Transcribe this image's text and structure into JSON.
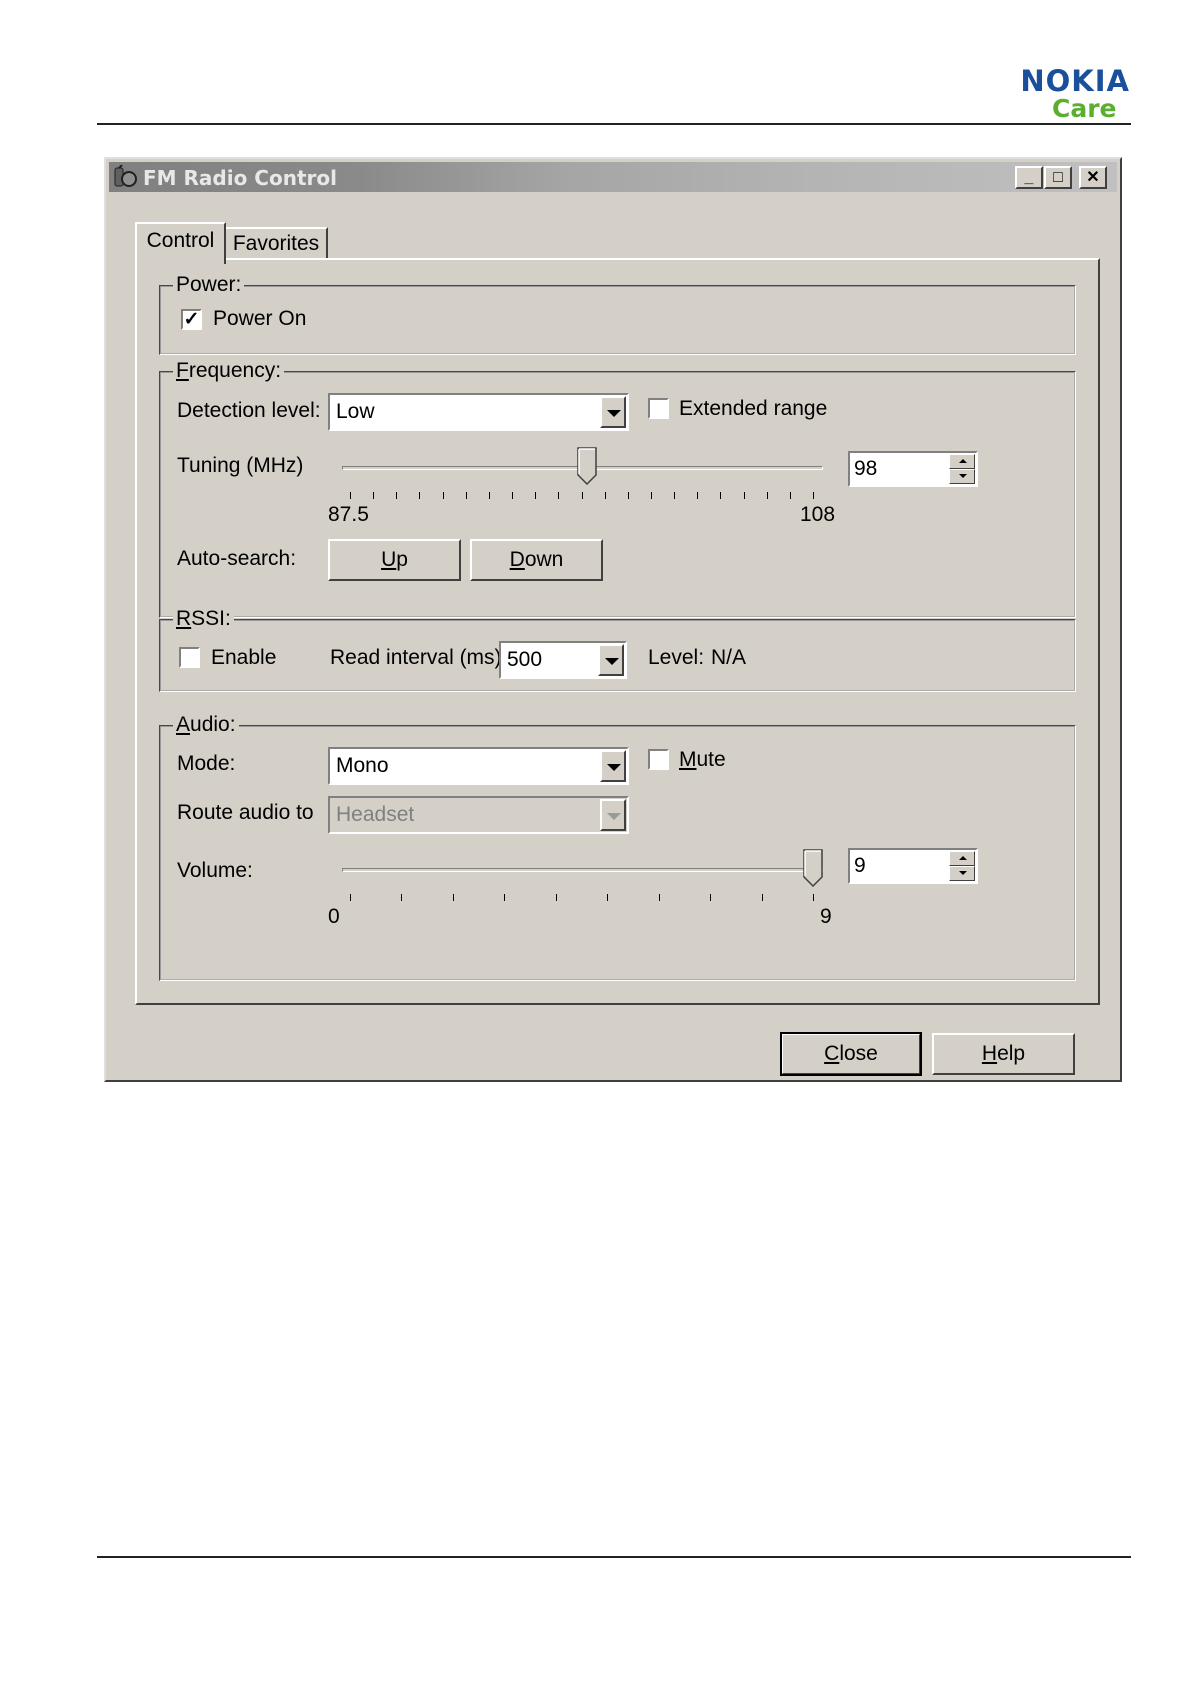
{
  "header": {
    "brand": "NOKIA",
    "sub_brand": "Care"
  },
  "window": {
    "title": "FM Radio Control",
    "controls": {
      "minimize": "_",
      "maximize": "□",
      "close": "✕"
    }
  },
  "tabs": [
    {
      "label": "Control",
      "active": true
    },
    {
      "label": "Favorites",
      "active": false
    }
  ],
  "power": {
    "group_label": "Power:",
    "power_on_label": "Power On",
    "power_on_checked": true
  },
  "frequency": {
    "group_label_underline": "F",
    "group_label_rest": "requency:",
    "detection_level_label": "Detection level:",
    "detection_level_value": "Low",
    "extended_range_label": "Extended range",
    "extended_range_checked": false,
    "tuning_label": "Tuning (MHz)",
    "tuning_value": "98",
    "tuning_min_label": "87.5",
    "tuning_max_label": "108",
    "tuning_min": 87.5,
    "tuning_max": 108,
    "tuning_current": 98,
    "auto_search_label": "Auto-search:",
    "up_button_underline": "U",
    "up_button_rest": "p",
    "down_button_underline": "D",
    "down_button_rest": "own"
  },
  "rssi": {
    "group_label_underline": "R",
    "group_label_rest": "SSI:",
    "enable_label": "Enable",
    "enable_checked": false,
    "read_interval_label": "Read interval (ms):",
    "read_interval_value": "500",
    "level_label": "Level:",
    "level_value": "N/A"
  },
  "audio": {
    "group_label_underline": "A",
    "group_label_rest": "udio:",
    "mode_label": "Mode:",
    "mode_value": "Mono",
    "mute_label_underline": "M",
    "mute_label_rest": "ute",
    "mute_checked": false,
    "route_label": "Route audio to",
    "route_value": "Headset",
    "route_disabled": true,
    "volume_label": "Volume:",
    "volume_value": "9",
    "volume_min_label": "0",
    "volume_max_label": "9",
    "volume_min": 0,
    "volume_max": 9,
    "volume_current": 9
  },
  "footer_buttons": {
    "close_underline": "C",
    "close_rest": "lose",
    "help_underline": "H",
    "help_rest": "elp"
  }
}
